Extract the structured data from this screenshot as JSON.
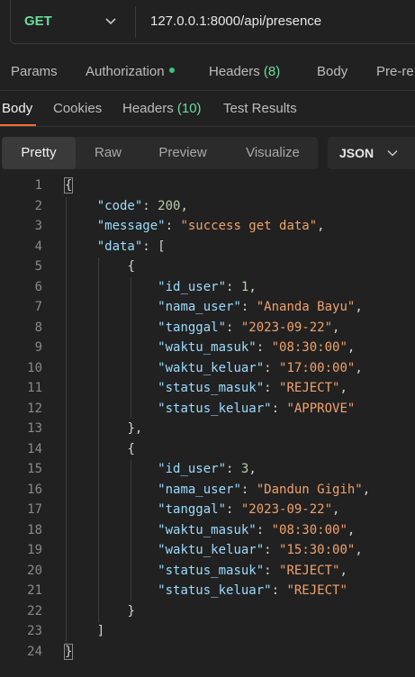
{
  "request": {
    "method": "GET",
    "url": "127.0.0.1:8000/api/presence"
  },
  "request_tabs": [
    {
      "label": "Params",
      "count": ""
    },
    {
      "label": "Authorization",
      "count": ""
    },
    {
      "label": "Headers",
      "count": "(8)"
    },
    {
      "label": "Body",
      "count": ""
    },
    {
      "label": "Pre-re",
      "count": ""
    }
  ],
  "response_tabs": [
    {
      "label": "Body",
      "count": ""
    },
    {
      "label": "Cookies",
      "count": ""
    },
    {
      "label": "Headers",
      "count": "(10)"
    },
    {
      "label": "Test Results",
      "count": ""
    }
  ],
  "view_modes": [
    "Pretty",
    "Raw",
    "Preview",
    "Visualize"
  ],
  "format": "JSON",
  "colors": {
    "method": "#6bdd9a",
    "accent": "#ff6c37",
    "key": "#9cdcfe",
    "string": "#f0a26d"
  },
  "code_lines": [
    {
      "n": "1",
      "i": 0,
      "t": [
        [
          "p",
          "{"
        ]
      ]
    },
    {
      "n": "2",
      "i": 1,
      "t": [
        [
          "k",
          "\"code\""
        ],
        [
          "p",
          ": "
        ],
        [
          "n",
          "200"
        ],
        [
          "p",
          ","
        ]
      ]
    },
    {
      "n": "3",
      "i": 1,
      "t": [
        [
          "k",
          "\"message\""
        ],
        [
          "p",
          ": "
        ],
        [
          "s",
          "\"success get data\""
        ],
        [
          "p",
          ","
        ]
      ]
    },
    {
      "n": "4",
      "i": 1,
      "t": [
        [
          "k",
          "\"data\""
        ],
        [
          "p",
          ": ["
        ]
      ]
    },
    {
      "n": "5",
      "i": 2,
      "t": [
        [
          "p",
          "{"
        ]
      ]
    },
    {
      "n": "6",
      "i": 3,
      "t": [
        [
          "k",
          "\"id_user\""
        ],
        [
          "p",
          ": "
        ],
        [
          "n",
          "1"
        ],
        [
          "p",
          ","
        ]
      ]
    },
    {
      "n": "7",
      "i": 3,
      "t": [
        [
          "k",
          "\"nama_user\""
        ],
        [
          "p",
          ": "
        ],
        [
          "s",
          "\"Ananda Bayu\""
        ],
        [
          "p",
          ","
        ]
      ]
    },
    {
      "n": "8",
      "i": 3,
      "t": [
        [
          "k",
          "\"tanggal\""
        ],
        [
          "p",
          ": "
        ],
        [
          "s",
          "\"2023-09-22\""
        ],
        [
          "p",
          ","
        ]
      ]
    },
    {
      "n": "9",
      "i": 3,
      "t": [
        [
          "k",
          "\"waktu_masuk\""
        ],
        [
          "p",
          ": "
        ],
        [
          "s",
          "\"08:30:00\""
        ],
        [
          "p",
          ","
        ]
      ]
    },
    {
      "n": "10",
      "i": 3,
      "t": [
        [
          "k",
          "\"waktu_keluar\""
        ],
        [
          "p",
          ": "
        ],
        [
          "s",
          "\"17:00:00\""
        ],
        [
          "p",
          ","
        ]
      ]
    },
    {
      "n": "11",
      "i": 3,
      "t": [
        [
          "k",
          "\"status_masuk\""
        ],
        [
          "p",
          ": "
        ],
        [
          "s",
          "\"REJECT\""
        ],
        [
          "p",
          ","
        ]
      ]
    },
    {
      "n": "12",
      "i": 3,
      "t": [
        [
          "k",
          "\"status_keluar\""
        ],
        [
          "p",
          ": "
        ],
        [
          "s",
          "\"APPROVE\""
        ]
      ]
    },
    {
      "n": "13",
      "i": 2,
      "t": [
        [
          "p",
          "},"
        ]
      ]
    },
    {
      "n": "14",
      "i": 2,
      "t": [
        [
          "p",
          "{"
        ]
      ]
    },
    {
      "n": "15",
      "i": 3,
      "t": [
        [
          "k",
          "\"id_user\""
        ],
        [
          "p",
          ": "
        ],
        [
          "n",
          "3"
        ],
        [
          "p",
          ","
        ]
      ]
    },
    {
      "n": "16",
      "i": 3,
      "t": [
        [
          "k",
          "\"nama_user\""
        ],
        [
          "p",
          ": "
        ],
        [
          "s",
          "\"Dandun Gigih\""
        ],
        [
          "p",
          ","
        ]
      ]
    },
    {
      "n": "17",
      "i": 3,
      "t": [
        [
          "k",
          "\"tanggal\""
        ],
        [
          "p",
          ": "
        ],
        [
          "s",
          "\"2023-09-22\""
        ],
        [
          "p",
          ","
        ]
      ]
    },
    {
      "n": "18",
      "i": 3,
      "t": [
        [
          "k",
          "\"waktu_masuk\""
        ],
        [
          "p",
          ": "
        ],
        [
          "s",
          "\"08:30:00\""
        ],
        [
          "p",
          ","
        ]
      ]
    },
    {
      "n": "19",
      "i": 3,
      "t": [
        [
          "k",
          "\"waktu_keluar\""
        ],
        [
          "p",
          ": "
        ],
        [
          "s",
          "\"15:30:00\""
        ],
        [
          "p",
          ","
        ]
      ]
    },
    {
      "n": "20",
      "i": 3,
      "t": [
        [
          "k",
          "\"status_masuk\""
        ],
        [
          "p",
          ": "
        ],
        [
          "s",
          "\"REJECT\""
        ],
        [
          "p",
          ","
        ]
      ]
    },
    {
      "n": "21",
      "i": 3,
      "t": [
        [
          "k",
          "\"status_keluar\""
        ],
        [
          "p",
          ": "
        ],
        [
          "s",
          "\"REJECT\""
        ]
      ]
    },
    {
      "n": "22",
      "i": 2,
      "t": [
        [
          "p",
          "}"
        ]
      ]
    },
    {
      "n": "23",
      "i": 1,
      "t": [
        [
          "p",
          "]"
        ]
      ]
    },
    {
      "n": "24",
      "i": 0,
      "t": [
        [
          "p",
          "}"
        ]
      ]
    }
  ]
}
